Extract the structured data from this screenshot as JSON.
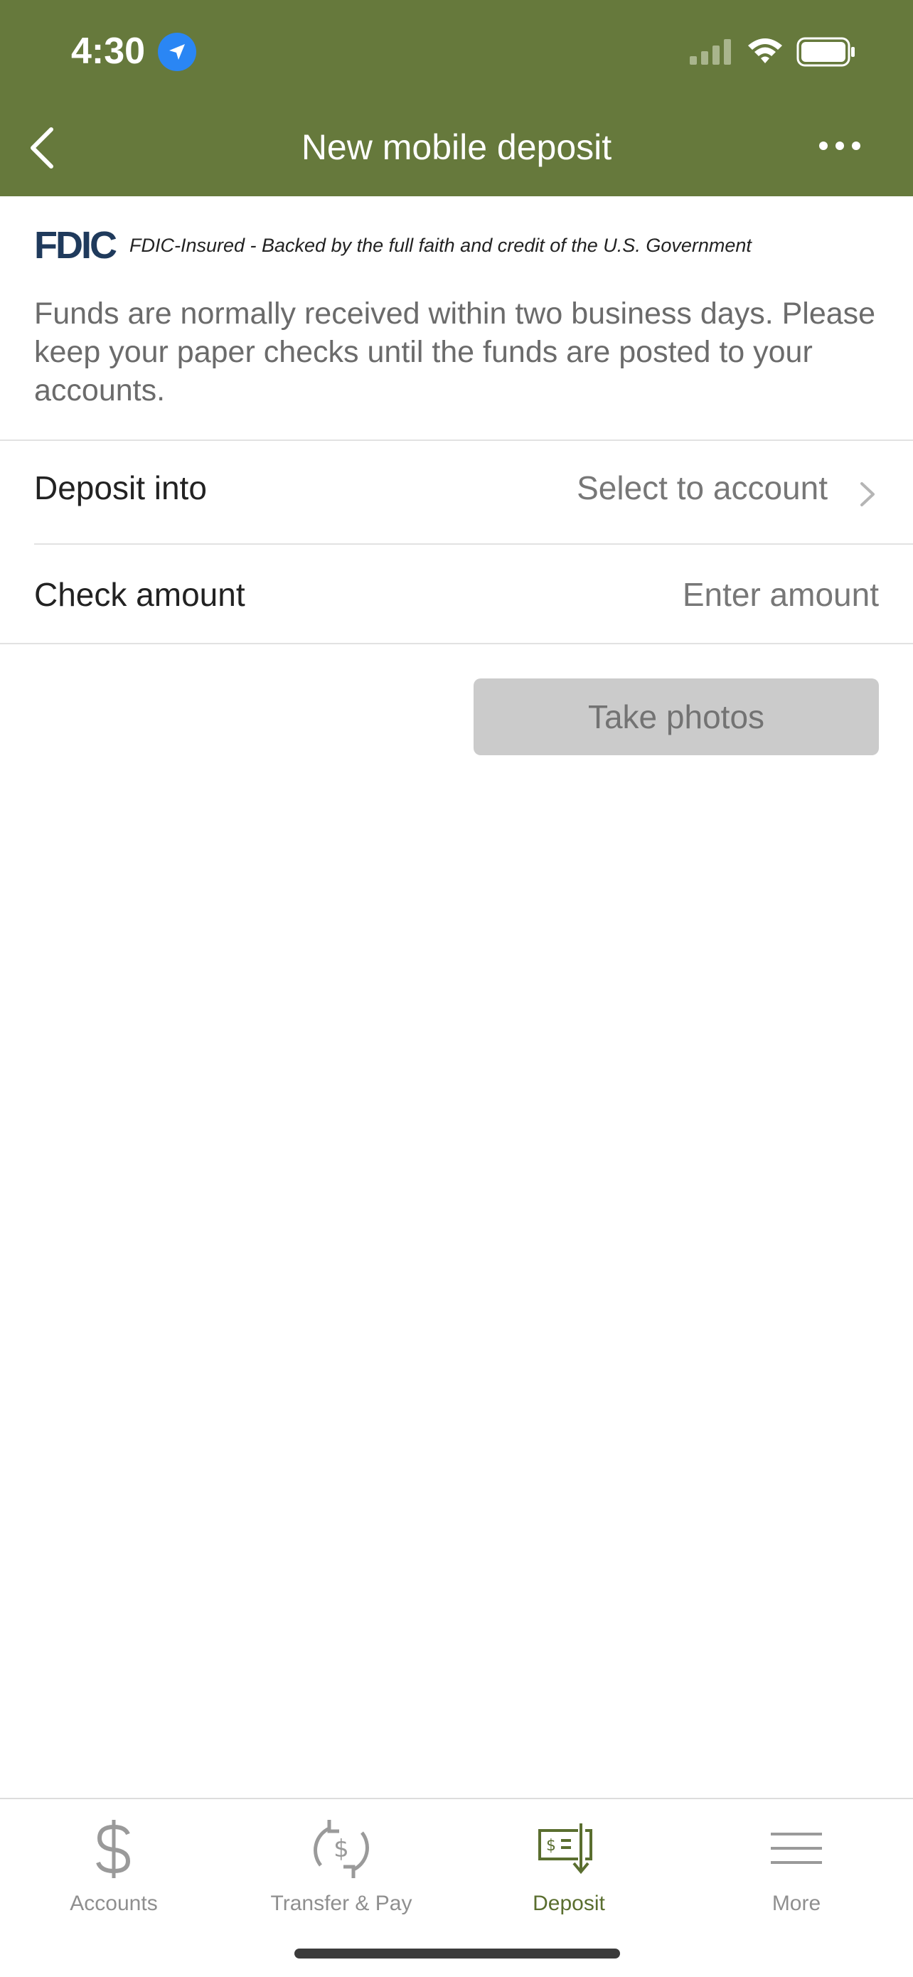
{
  "status_bar": {
    "time": "4:30",
    "icons": [
      "location-icon",
      "signal-icon",
      "wifi-icon",
      "battery-icon"
    ]
  },
  "nav": {
    "title": "New mobile deposit",
    "back_icon": "chevron-left-icon",
    "more_icon": "ellipsis-icon"
  },
  "fdic": {
    "logo": "FDIC",
    "text": "FDIC-Insured - Backed by the full faith and credit of the U.S. Government"
  },
  "info_text": "Funds are normally received within two business days. Please keep your paper checks until the funds are posted to your accounts.",
  "form": {
    "deposit_into_label": "Deposit into",
    "deposit_into_value": "Select to account",
    "check_amount_label": "Check amount",
    "check_amount_placeholder": "Enter amount"
  },
  "take_photos_label": "Take photos",
  "tabs": [
    {
      "label": "Accounts",
      "icon": "dollar-icon",
      "active": false
    },
    {
      "label": "Transfer & Pay",
      "icon": "transfer-dollar-icon",
      "active": false
    },
    {
      "label": "Deposit",
      "icon": "check-deposit-icon",
      "active": true
    },
    {
      "label": "More",
      "icon": "menu-icon",
      "active": false
    }
  ],
  "colors": {
    "header": "#66793c",
    "active_tab": "#5a6e2f",
    "button_disabled": "#cbcbcb",
    "fdic_blue": "#1f3a5c"
  }
}
